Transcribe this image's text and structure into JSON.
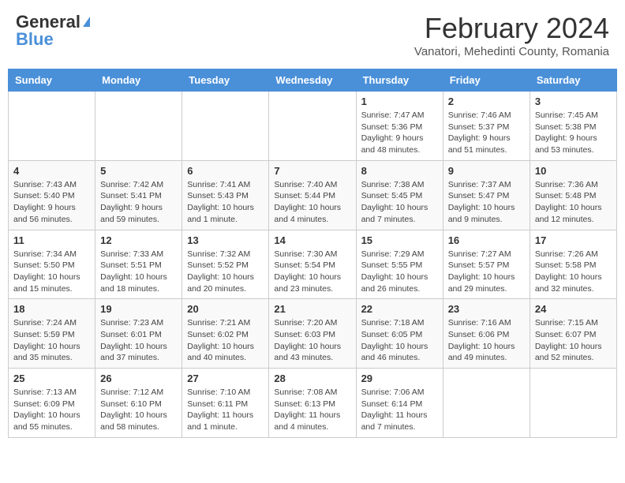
{
  "header": {
    "logo_general": "General",
    "logo_blue": "Blue",
    "month_title": "February 2024",
    "location": "Vanatori, Mehedinti County, Romania"
  },
  "days_of_week": [
    "Sunday",
    "Monday",
    "Tuesday",
    "Wednesday",
    "Thursday",
    "Friday",
    "Saturday"
  ],
  "weeks": [
    [
      {
        "date": "",
        "info": ""
      },
      {
        "date": "",
        "info": ""
      },
      {
        "date": "",
        "info": ""
      },
      {
        "date": "",
        "info": ""
      },
      {
        "date": "1",
        "info": "Sunrise: 7:47 AM\nSunset: 5:36 PM\nDaylight: 9 hours and 48 minutes."
      },
      {
        "date": "2",
        "info": "Sunrise: 7:46 AM\nSunset: 5:37 PM\nDaylight: 9 hours and 51 minutes."
      },
      {
        "date": "3",
        "info": "Sunrise: 7:45 AM\nSunset: 5:38 PM\nDaylight: 9 hours and 53 minutes."
      }
    ],
    [
      {
        "date": "4",
        "info": "Sunrise: 7:43 AM\nSunset: 5:40 PM\nDaylight: 9 hours and 56 minutes."
      },
      {
        "date": "5",
        "info": "Sunrise: 7:42 AM\nSunset: 5:41 PM\nDaylight: 9 hours and 59 minutes."
      },
      {
        "date": "6",
        "info": "Sunrise: 7:41 AM\nSunset: 5:43 PM\nDaylight: 10 hours and 1 minute."
      },
      {
        "date": "7",
        "info": "Sunrise: 7:40 AM\nSunset: 5:44 PM\nDaylight: 10 hours and 4 minutes."
      },
      {
        "date": "8",
        "info": "Sunrise: 7:38 AM\nSunset: 5:45 PM\nDaylight: 10 hours and 7 minutes."
      },
      {
        "date": "9",
        "info": "Sunrise: 7:37 AM\nSunset: 5:47 PM\nDaylight: 10 hours and 9 minutes."
      },
      {
        "date": "10",
        "info": "Sunrise: 7:36 AM\nSunset: 5:48 PM\nDaylight: 10 hours and 12 minutes."
      }
    ],
    [
      {
        "date": "11",
        "info": "Sunrise: 7:34 AM\nSunset: 5:50 PM\nDaylight: 10 hours and 15 minutes."
      },
      {
        "date": "12",
        "info": "Sunrise: 7:33 AM\nSunset: 5:51 PM\nDaylight: 10 hours and 18 minutes."
      },
      {
        "date": "13",
        "info": "Sunrise: 7:32 AM\nSunset: 5:52 PM\nDaylight: 10 hours and 20 minutes."
      },
      {
        "date": "14",
        "info": "Sunrise: 7:30 AM\nSunset: 5:54 PM\nDaylight: 10 hours and 23 minutes."
      },
      {
        "date": "15",
        "info": "Sunrise: 7:29 AM\nSunset: 5:55 PM\nDaylight: 10 hours and 26 minutes."
      },
      {
        "date": "16",
        "info": "Sunrise: 7:27 AM\nSunset: 5:57 PM\nDaylight: 10 hours and 29 minutes."
      },
      {
        "date": "17",
        "info": "Sunrise: 7:26 AM\nSunset: 5:58 PM\nDaylight: 10 hours and 32 minutes."
      }
    ],
    [
      {
        "date": "18",
        "info": "Sunrise: 7:24 AM\nSunset: 5:59 PM\nDaylight: 10 hours and 35 minutes."
      },
      {
        "date": "19",
        "info": "Sunrise: 7:23 AM\nSunset: 6:01 PM\nDaylight: 10 hours and 37 minutes."
      },
      {
        "date": "20",
        "info": "Sunrise: 7:21 AM\nSunset: 6:02 PM\nDaylight: 10 hours and 40 minutes."
      },
      {
        "date": "21",
        "info": "Sunrise: 7:20 AM\nSunset: 6:03 PM\nDaylight: 10 hours and 43 minutes."
      },
      {
        "date": "22",
        "info": "Sunrise: 7:18 AM\nSunset: 6:05 PM\nDaylight: 10 hours and 46 minutes."
      },
      {
        "date": "23",
        "info": "Sunrise: 7:16 AM\nSunset: 6:06 PM\nDaylight: 10 hours and 49 minutes."
      },
      {
        "date": "24",
        "info": "Sunrise: 7:15 AM\nSunset: 6:07 PM\nDaylight: 10 hours and 52 minutes."
      }
    ],
    [
      {
        "date": "25",
        "info": "Sunrise: 7:13 AM\nSunset: 6:09 PM\nDaylight: 10 hours and 55 minutes."
      },
      {
        "date": "26",
        "info": "Sunrise: 7:12 AM\nSunset: 6:10 PM\nDaylight: 10 hours and 58 minutes."
      },
      {
        "date": "27",
        "info": "Sunrise: 7:10 AM\nSunset: 6:11 PM\nDaylight: 11 hours and 1 minute."
      },
      {
        "date": "28",
        "info": "Sunrise: 7:08 AM\nSunset: 6:13 PM\nDaylight: 11 hours and 4 minutes."
      },
      {
        "date": "29",
        "info": "Sunrise: 7:06 AM\nSunset: 6:14 PM\nDaylight: 11 hours and 7 minutes."
      },
      {
        "date": "",
        "info": ""
      },
      {
        "date": "",
        "info": ""
      }
    ]
  ]
}
